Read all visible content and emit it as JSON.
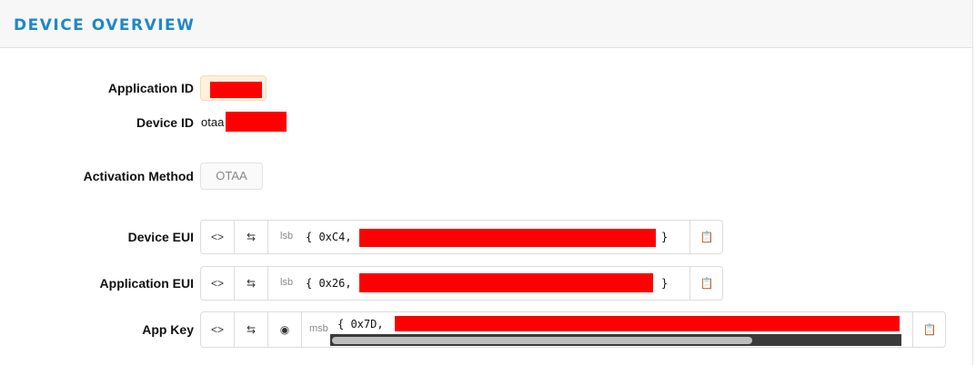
{
  "header": {
    "title": "DEVICE OVERVIEW"
  },
  "fields": {
    "application_id_label": "Application ID",
    "device_id_label": "Device ID",
    "device_id_prefix": "otaa",
    "activation_method_label": "Activation Method",
    "activation_method_value": "OTAA",
    "device_eui_label": "Device EUI",
    "application_eui_label": "Application EUI",
    "app_key_label": "App Key"
  },
  "device_eui": {
    "toggle_format_icon": "<>",
    "swap_icon": "⇆",
    "byte_order": "lsb",
    "value_start": "{ 0xC4,",
    "value_end": "}",
    "copy_icon": "clipboard-icon"
  },
  "application_eui": {
    "toggle_format_icon": "<>",
    "swap_icon": "⇆",
    "byte_order": "lsb",
    "value_start": "{ 0x26,",
    "value_end": "}",
    "copy_icon": "clipboard-icon"
  },
  "app_key": {
    "toggle_format_icon": "<>",
    "swap_icon": "⇆",
    "visibility_icon": "eye-slash-icon",
    "byte_order": "msb",
    "value_start": "{ 0x7D,",
    "copy_icon": "clipboard-icon"
  },
  "colors": {
    "accent": "#1e88c8",
    "redaction": "#ff0000",
    "highlight_bg": "#fdf0dc"
  }
}
